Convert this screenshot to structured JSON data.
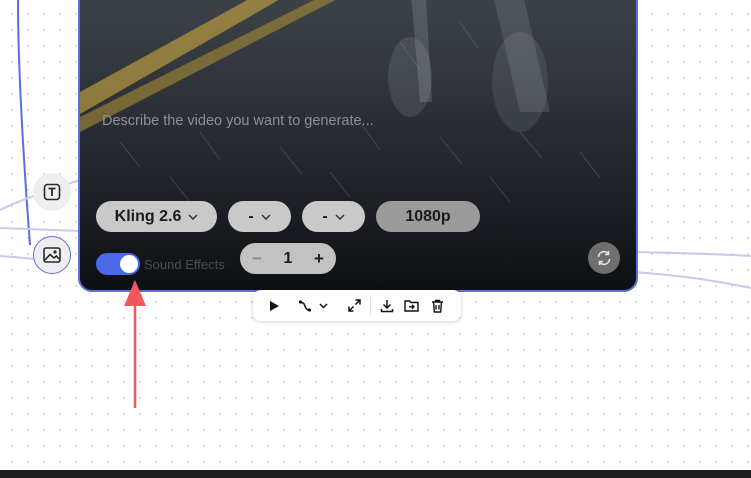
{
  "colors": {
    "accent": "#5b6fd8",
    "toggle_on": "#4c68e8",
    "annotation_arrow": "#f0585b"
  },
  "node": {
    "prompt_placeholder": "Describe the video you want to generate...",
    "model_label": "Kling 2.6",
    "option_1_label": "-",
    "option_2_label": "-",
    "resolution_label": "1080p",
    "sound_effects_label": "Sound Effects",
    "sound_effects_enabled": true,
    "count_value": "1",
    "count_minus": "−",
    "count_plus": "+"
  },
  "side_buttons": [
    {
      "icon": "text-icon"
    },
    {
      "icon": "image-icon"
    }
  ],
  "toolbar": {
    "icons": [
      "play-icon",
      "connector-icon",
      "chevron-down-icon",
      "expand-icon",
      "download-icon",
      "move-to-folder-icon",
      "trash-icon"
    ]
  }
}
